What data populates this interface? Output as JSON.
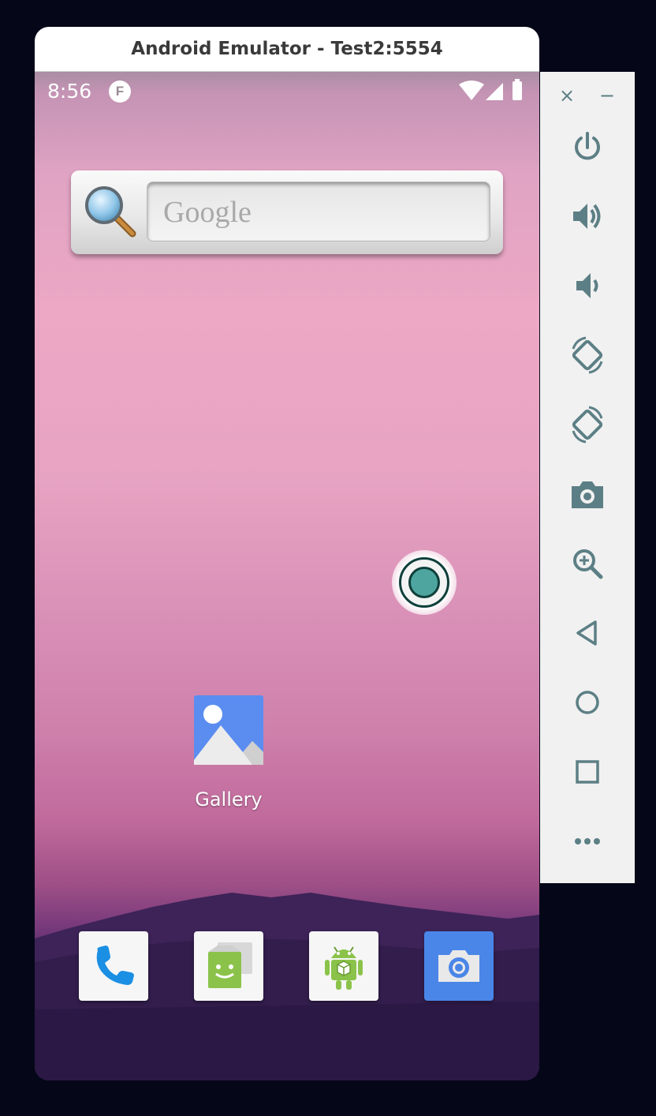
{
  "window": {
    "title": "Android Emulator - Test2:5554"
  },
  "statusbar": {
    "time": "8:56",
    "notification_glyph": "F"
  },
  "search_widget": {
    "placeholder": "Google"
  },
  "home_apps": [
    {
      "label": "Gallery"
    }
  ],
  "dock": [
    {
      "name": "phone"
    },
    {
      "name": "messaging"
    },
    {
      "name": "android-app"
    },
    {
      "name": "camera"
    }
  ],
  "sidebar": {
    "close_glyph": "×",
    "minimize_glyph": "−",
    "buttons": [
      "power",
      "volume-up",
      "volume-down",
      "rotate-left",
      "rotate-right",
      "screenshot",
      "zoom",
      "back",
      "home",
      "overview",
      "more"
    ]
  },
  "colors": {
    "accent": "#5c7f85",
    "touch_dot": "#4ea59f",
    "camera_blue": "#4a86e8",
    "phone_blue": "#1a8fe3"
  }
}
